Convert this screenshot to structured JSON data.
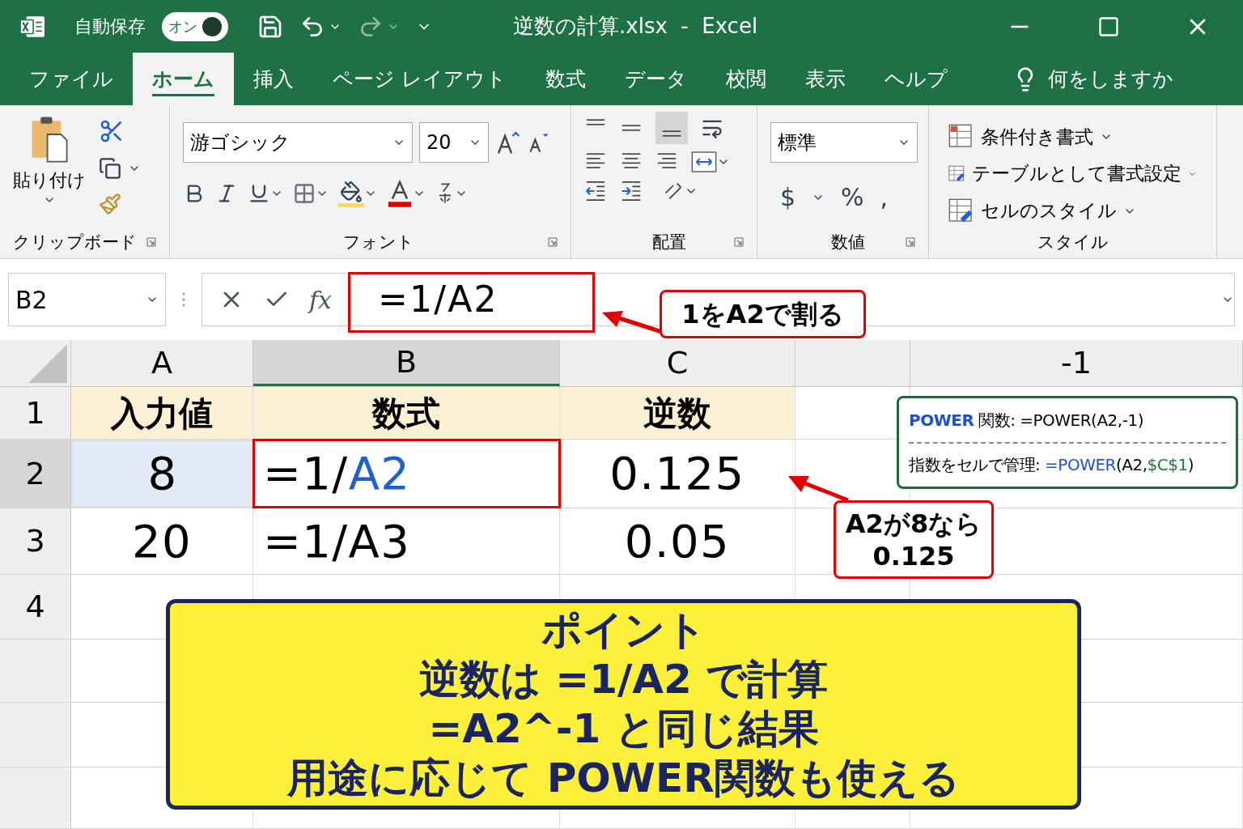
{
  "title_bar": {
    "autosave_label": "自動保存",
    "autosave_toggle": {
      "label": "オン",
      "on": true
    },
    "title": "逆数の計算.xlsx  -  Excel"
  },
  "tabs": [
    {
      "label": "ファイル",
      "selected": false
    },
    {
      "label": "ホーム",
      "selected": true
    },
    {
      "label": "挿入",
      "selected": false
    },
    {
      "label": "ページ レイアウト",
      "selected": false
    },
    {
      "label": "数式",
      "selected": false
    },
    {
      "label": "データ",
      "selected": false
    },
    {
      "label": "校閲",
      "selected": false
    },
    {
      "label": "表示",
      "selected": false
    },
    {
      "label": "ヘルプ",
      "selected": false
    }
  ],
  "tell_me": "何をしますか",
  "ribbon": {
    "clipboard": {
      "paste": "貼り付け",
      "label": "クリップボード"
    },
    "font": {
      "name": "游ゴシック",
      "size": "20",
      "label": "フォント"
    },
    "alignment": {
      "label": "配置"
    },
    "number": {
      "format": "標準",
      "buttons": [
        "$",
        "%",
        ","
      ],
      "label": "数値"
    },
    "styles": {
      "items": [
        "条件付き書式",
        "テーブルとして書式設定",
        "セルのスタイル"
      ],
      "label": "スタイル"
    }
  },
  "formula_bar": {
    "name_box": "B2",
    "function_label": "fx",
    "formula": "=1/A2"
  },
  "columns": [
    {
      "label": "A",
      "selected": false
    },
    {
      "label": "B",
      "selected": true
    },
    {
      "label": "C",
      "selected": false
    },
    {
      "selected": false
    },
    {
      "label": "-1",
      "selected": false
    }
  ],
  "rows": [
    {
      "header": "1",
      "selected": false,
      "kind": "header",
      "cells": [
        {
          "segments": [
            {
              "text": "入力値"
            }
          ]
        },
        {
          "segments": [
            {
              "text": "数式"
            }
          ]
        },
        {
          "segments": [
            {
              "text": "逆数"
            }
          ]
        }
      ]
    },
    {
      "header": "2",
      "selected": true,
      "kind": "data",
      "cells": [
        {
          "segments": [
            {
              "text": "8"
            }
          ],
          "selected": true
        },
        {
          "segments": [
            {
              "text": "=1/"
            },
            {
              "text": "A2",
              "color": "#1f5fd6"
            }
          ],
          "selected": false
        },
        {
          "segments": [
            {
              "text": "0.125"
            }
          ],
          "selected": false
        }
      ]
    },
    {
      "header": "3",
      "selected": false,
      "kind": "data",
      "cells": [
        {
          "segments": [
            {
              "text": "20"
            }
          ],
          "selected": false
        },
        {
          "segments": [
            {
              "text": "=1/A3"
            }
          ],
          "selected": false
        },
        {
          "segments": [
            {
              "text": "0.05"
            }
          ],
          "selected": false
        }
      ]
    },
    {
      "header": "4",
      "selected": false,
      "cells": []
    },
    {
      "selected": false,
      "cells": []
    },
    {
      "selected": false,
      "cells": []
    },
    {
      "selected": false,
      "cells": []
    }
  ],
  "callouts": [
    {
      "lines": [
        "1をA2で割る"
      ]
    },
    {
      "lines": [
        "A2が8なら",
        "0.125"
      ]
    }
  ],
  "power_note": {
    "lines": [
      [
        {
          "text": "**POWER**",
          "color": "#1f4fd6"
        },
        {
          "text": " 関数: =POWER(A2,-1)"
        }
      ],
      [
        {
          "text": "指数をセルで管理: "
        },
        {
          "text": "=POWER",
          "color": "#1f4fd6"
        },
        {
          "text": "(A2,"
        },
        {
          "text": "$C$1",
          "color": "#1a7a3a"
        },
        {
          "text": ")"
        }
      ]
    ]
  },
  "point_box": {
    "lines": [
      "ポイント",
      "逆数は =1/A2 で計算",
      "=A2^-1 と同じ結果",
      "用途に応じて POWER関数も使える"
    ]
  }
}
